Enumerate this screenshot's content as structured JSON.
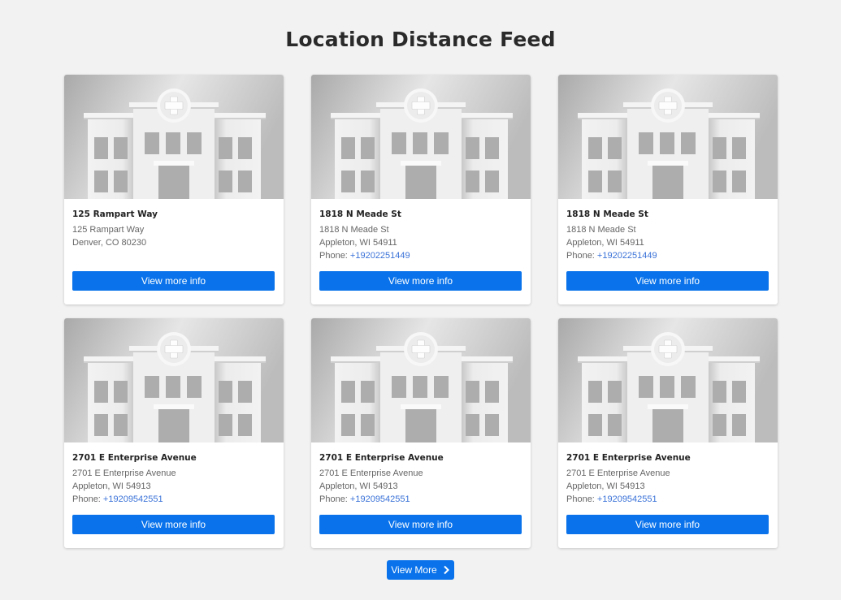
{
  "page": {
    "title": "Location Distance Feed"
  },
  "cards": [
    {
      "title": "125 Rampart Way",
      "address_line1": "125 Rampart Way",
      "address_line2": "Denver, CO 80230",
      "phone_label": "",
      "phone": "",
      "button_label": "View more info",
      "image_icon": "hospital-building-icon"
    },
    {
      "title": "1818 N Meade St",
      "address_line1": "1818 N Meade St",
      "address_line2": "Appleton, WI 54911",
      "phone_label": "Phone: ",
      "phone": "+19202251449",
      "button_label": "View more info",
      "image_icon": "hospital-building-icon"
    },
    {
      "title": "1818 N Meade St",
      "address_line1": "1818 N Meade St",
      "address_line2": "Appleton, WI 54911",
      "phone_label": "Phone: ",
      "phone": "+19202251449",
      "button_label": "View more info",
      "image_icon": "hospital-building-icon"
    },
    {
      "title": "2701 E Enterprise Avenue",
      "address_line1": "2701 E Enterprise Avenue",
      "address_line2": "Appleton, WI 54913",
      "phone_label": "Phone: ",
      "phone": "+19209542551",
      "button_label": "View more info",
      "image_icon": "hospital-building-icon"
    },
    {
      "title": "2701 E Enterprise Avenue",
      "address_line1": "2701 E Enterprise Avenue",
      "address_line2": "Appleton, WI 54913",
      "phone_label": "Phone: ",
      "phone": "+19209542551",
      "button_label": "View more info",
      "image_icon": "hospital-building-icon"
    },
    {
      "title": "2701 E Enterprise Avenue",
      "address_line1": "2701 E Enterprise Avenue",
      "address_line2": "Appleton, WI 54913",
      "phone_label": "Phone: ",
      "phone": "+19209542551",
      "button_label": "View more info",
      "image_icon": "hospital-building-icon"
    }
  ],
  "footer": {
    "view_more_label": "View More",
    "view_more_icon": "chevron-right-icon"
  },
  "colors": {
    "accent": "#0a73eb",
    "link": "#3a72d8",
    "background": "#f2f2f2"
  }
}
